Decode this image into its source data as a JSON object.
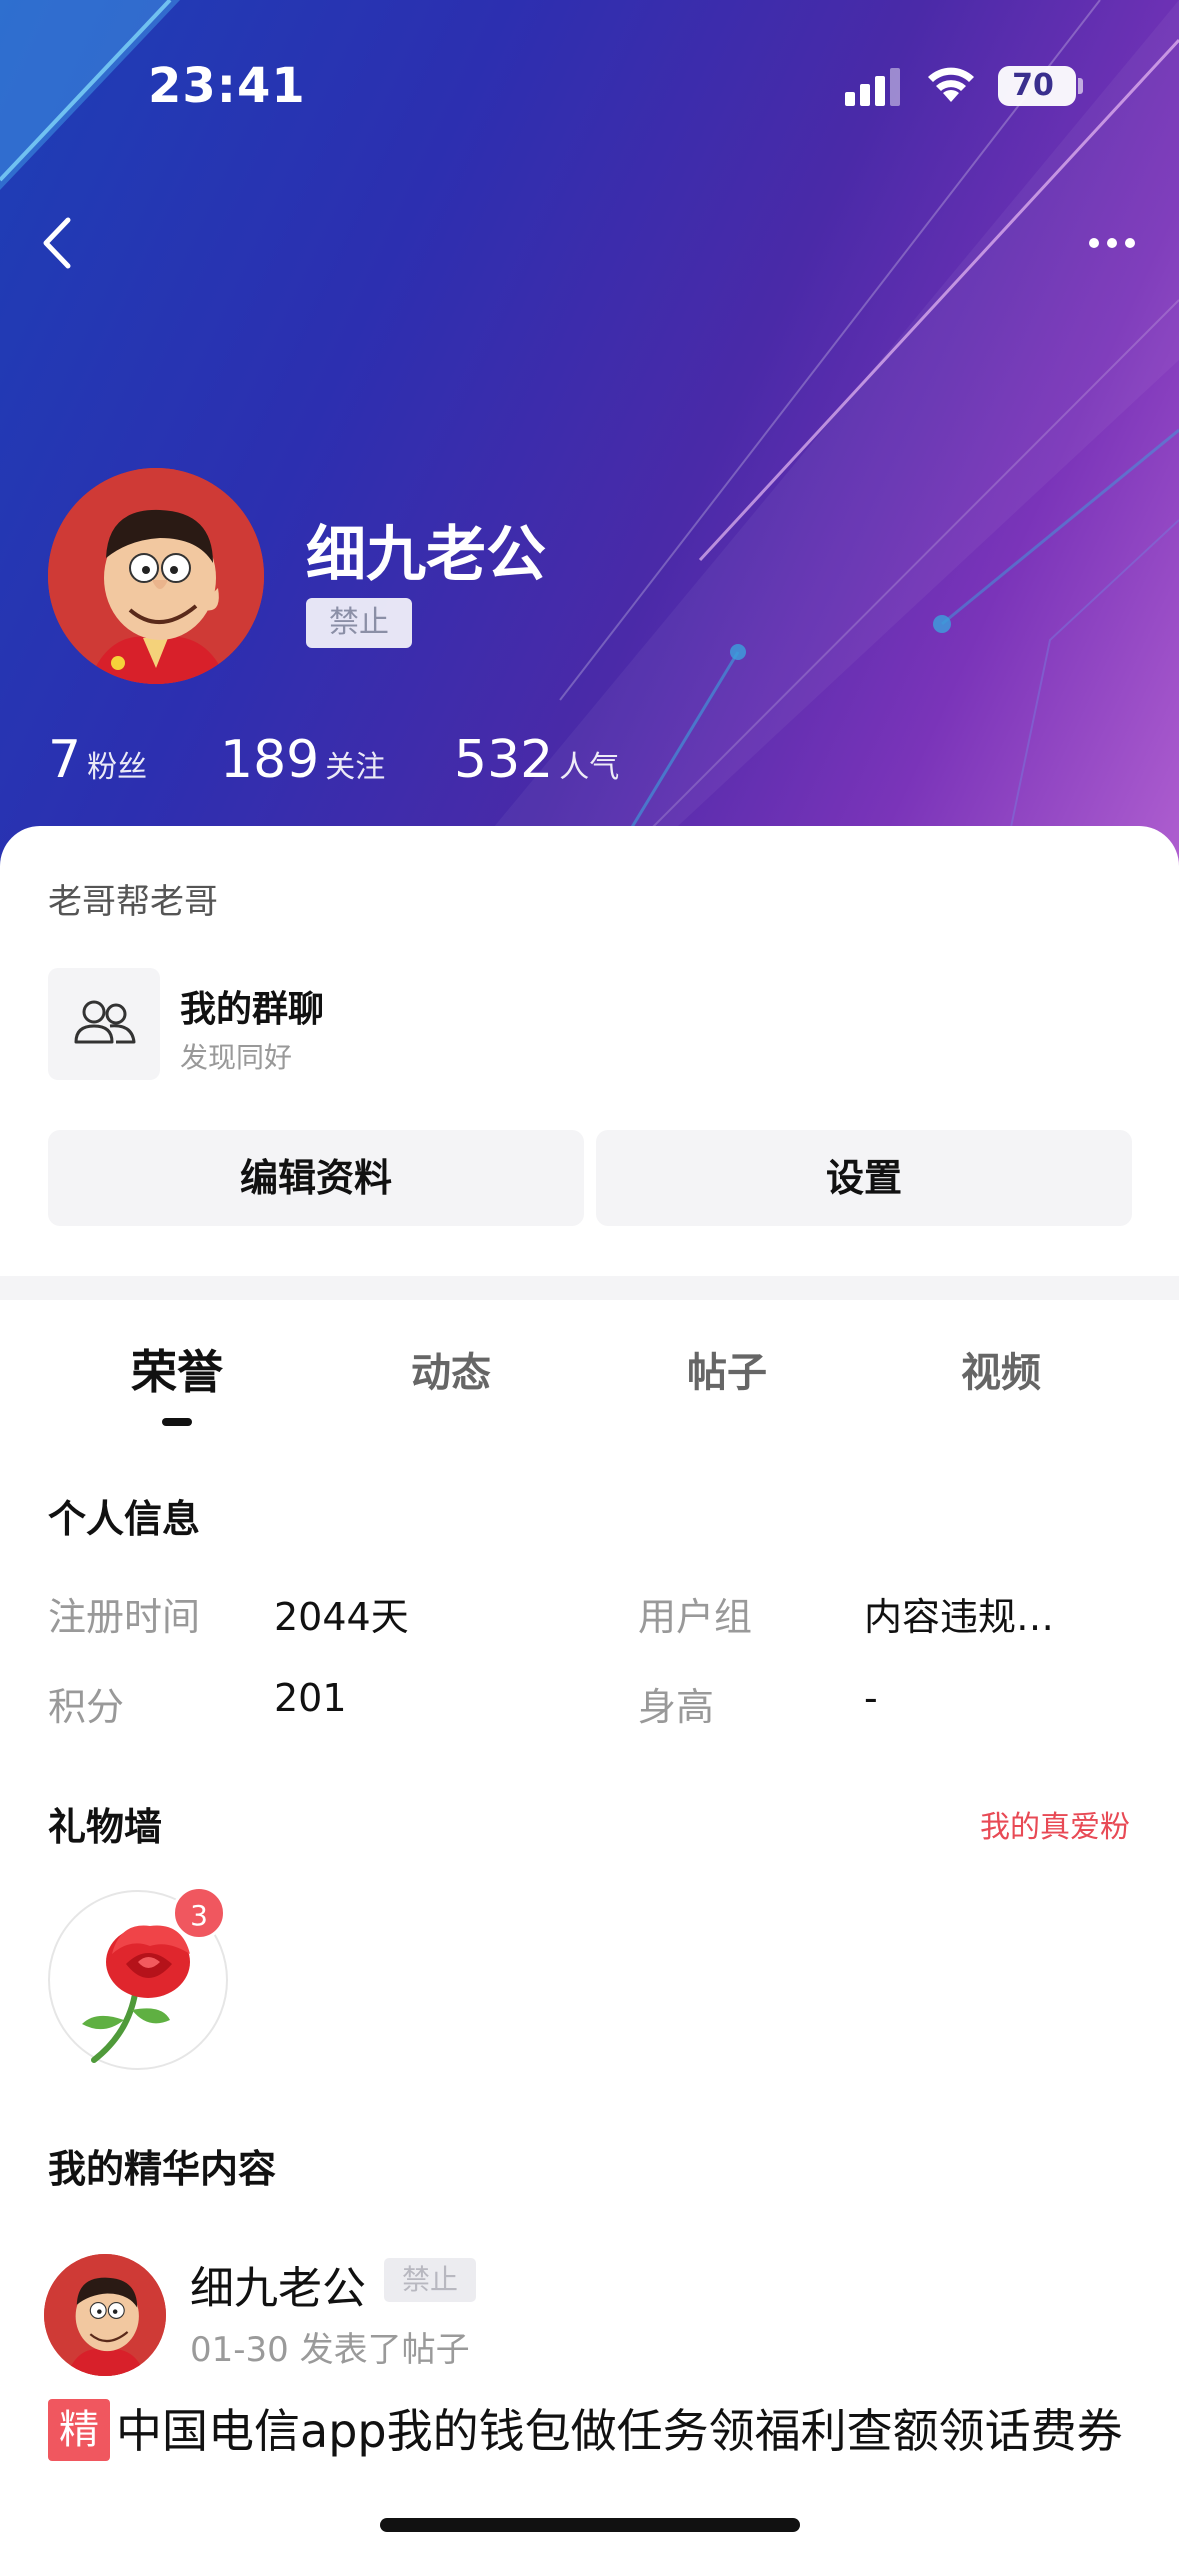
{
  "status_bar": {
    "time": "23:41",
    "battery": "70"
  },
  "profile": {
    "name": "细九老公",
    "status_badge": "禁止",
    "stats": [
      {
        "value": "7",
        "label": "粉丝"
      },
      {
        "value": "189",
        "label": "关注"
      },
      {
        "value": "532",
        "label": "人气"
      }
    ]
  },
  "card": {
    "title": "老哥帮老哥",
    "group": {
      "name": "我的群聊",
      "subtitle": "发现同好"
    },
    "edit_button": "编辑资料",
    "settings_button": "设置"
  },
  "tabs": [
    "荣誉",
    "动态",
    "帖子",
    "视频"
  ],
  "personal_info": {
    "title": "个人信息",
    "fields": [
      {
        "label": "注册时间",
        "value": "2044天"
      },
      {
        "label": "用户组",
        "value": "内容违规…"
      },
      {
        "label": "积分",
        "value": "201"
      },
      {
        "label": "身高",
        "value": "-"
      }
    ]
  },
  "gift_wall": {
    "title": "礼物墙",
    "link": "我的真爱粉",
    "gift_icon": "rose-icon",
    "gift_count": "3"
  },
  "featured": {
    "title": "我的精华内容",
    "post": {
      "author": "细九老公",
      "badge": "禁止",
      "meta": "01-30 发表了帖子",
      "tag": "精",
      "content": "中国电信app我的钱包做任务领福利查额领话费券"
    }
  },
  "colors": {
    "accent_red": "#f0575f",
    "link_red": "#e84a55",
    "header_blue": "#2c2fb0",
    "header_purple": "#7a34b9"
  }
}
